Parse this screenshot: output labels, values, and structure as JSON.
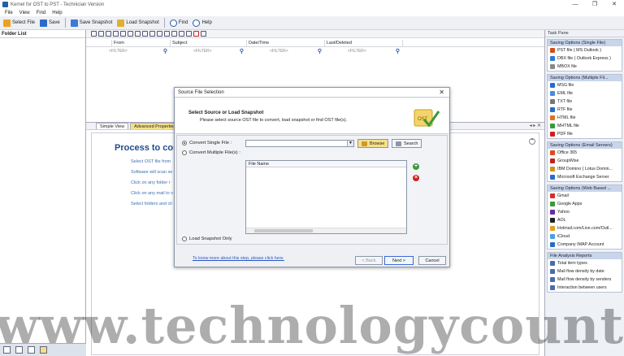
{
  "window": {
    "title": "Kernel for OST to PST - Technician Version",
    "controls": [
      "—",
      "❐",
      "✕"
    ]
  },
  "menu": [
    "File",
    "View",
    "Find",
    "Help"
  ],
  "toolbar": [
    {
      "label": "Select File",
      "icon": "select-file-icon",
      "color": "#f0a020"
    },
    {
      "label": "Save",
      "icon": "save-icon",
      "color": "#2a6acb"
    },
    {
      "label": "Save Snapshot",
      "icon": "save-snapshot-icon",
      "color": "#3a7ad8"
    },
    {
      "label": "Load Snapshot",
      "icon": "load-snapshot-icon",
      "color": "#e0b030"
    },
    {
      "label": "Find",
      "icon": "find-icon",
      "color": "#2a57a8"
    },
    {
      "label": "Help",
      "icon": "help-icon",
      "color": "#2a57a8"
    }
  ],
  "left_pane": {
    "title": "Folder List"
  },
  "grid": {
    "columns": [
      "From",
      "Subject",
      "Date/Time",
      "Last/Deleted"
    ],
    "filters": [
      "<FILTER>",
      "<FILTER>",
      "<FILTER>",
      "<FILTER>"
    ]
  },
  "tabs": [
    "Simple View",
    "Advanced Properties"
  ],
  "welcome": {
    "title": "Process to conv",
    "steps": [
      "Select OST file from",
      "Software will scan se",
      "Click on any folder r",
      "Click on any mail to v",
      "Select folders and cli"
    ]
  },
  "task_pane": {
    "title": "Task Pane",
    "groups": [
      {
        "title": "Saving Options (Single File)",
        "items": [
          {
            "label": "PST file ( MS Outlook )",
            "color": "#d84a1b"
          },
          {
            "label": "DBX file ( Outlook Express )",
            "color": "#2a7ad8"
          },
          {
            "label": "MBOX file",
            "color": "#888"
          }
        ]
      },
      {
        "title": "Saving Options (Multiple Fil...",
        "items": [
          {
            "label": "MSG file",
            "color": "#2a6acb"
          },
          {
            "label": "EML file",
            "color": "#4a8ad8"
          },
          {
            "label": "TXT file",
            "color": "#777"
          },
          {
            "label": "RTF file",
            "color": "#2a6acb"
          },
          {
            "label": "HTML file",
            "color": "#e07020"
          },
          {
            "label": "MHTML file",
            "color": "#3a9a3a"
          },
          {
            "label": "PDF file",
            "color": "#d02020"
          }
        ]
      },
      {
        "title": "Saving Options (Email Servers)",
        "items": [
          {
            "label": "Office 365",
            "color": "#e04a1a"
          },
          {
            "label": "GroupWise",
            "color": "#c02020"
          },
          {
            "label": "IBM Domino ( Lotus Domin...",
            "color": "#d09020"
          },
          {
            "label": "Microsoft Exchange Server",
            "color": "#2a6acb"
          }
        ]
      },
      {
        "title": "Saving Options (Web Based ...",
        "items": [
          {
            "label": "Gmail",
            "color": "#d03030"
          },
          {
            "label": "Google Apps",
            "color": "#3a9a3a"
          },
          {
            "label": "Yahoo",
            "color": "#6a2aa8"
          },
          {
            "label": "AOL",
            "color": "#222"
          },
          {
            "label": "Hotmail.com/Live.com/Outl...",
            "color": "#e0a020"
          },
          {
            "label": "iCloud",
            "color": "#4aa0e0"
          },
          {
            "label": "Company IMAP Account",
            "color": "#2a6acb"
          }
        ]
      },
      {
        "title": "File Analysis Reports",
        "items": [
          {
            "label": "Total item types",
            "color": "#4a6ab0"
          },
          {
            "label": "Mail flow density by date",
            "color": "#4a6ab0"
          },
          {
            "label": "Mail flow density by senders",
            "color": "#4a6ab0"
          },
          {
            "label": "Interaction between users",
            "color": "#4a6ab0"
          }
        ]
      }
    ]
  },
  "dialog": {
    "title": "Source File Selection",
    "heading": "Select Source or Load Snapshot",
    "subtitle": "Please select source OST file to convert, load snapshot or find OST file(s).",
    "logo_text": "OST",
    "option_single": "Convert Single File :",
    "option_multiple": "Convert Multiple File(s) :",
    "option_snapshot": "Load Snapshot Only",
    "browse": "Browse",
    "search": "Search",
    "file_name_header": "File Name",
    "link": "To know more about this step, please click here.",
    "back": "< Back",
    "next": "Next >",
    "cancel": "Cancel"
  },
  "watermark": "www.technologycounter.c"
}
